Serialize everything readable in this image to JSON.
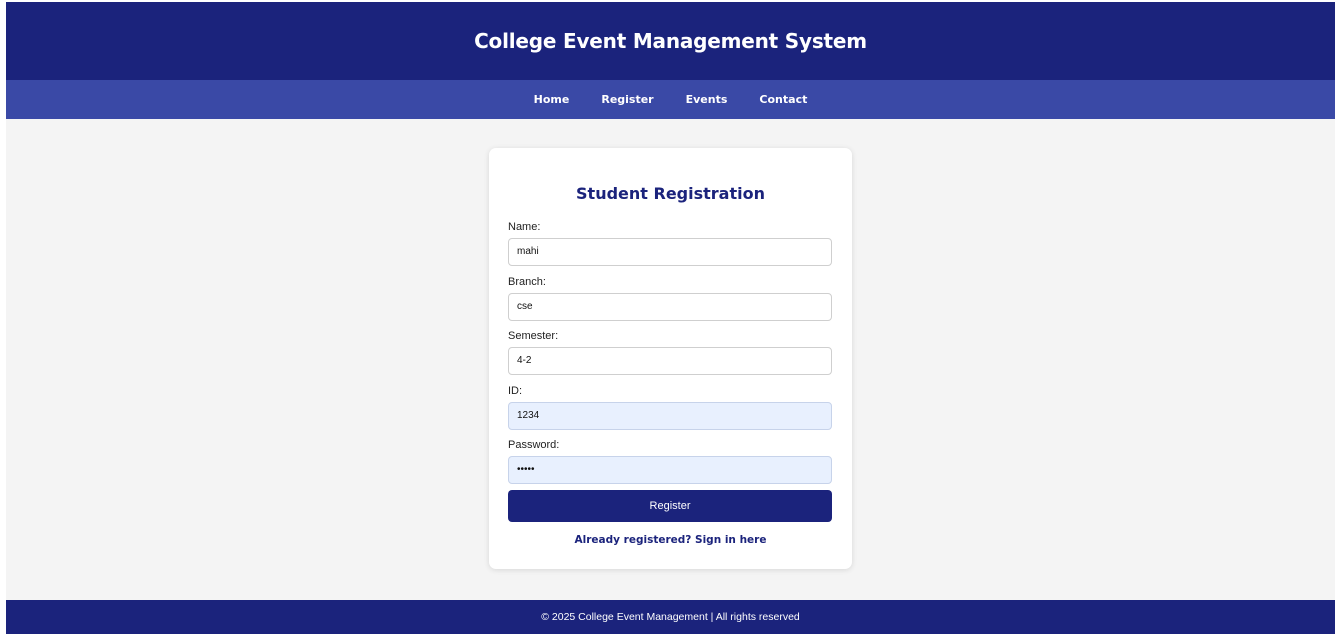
{
  "header": {
    "title": "College Event Management System"
  },
  "nav": {
    "items": [
      {
        "label": "Home"
      },
      {
        "label": "Register"
      },
      {
        "label": "Events"
      },
      {
        "label": "Contact"
      }
    ]
  },
  "form": {
    "title": "Student Registration",
    "fields": [
      {
        "label": "Name:",
        "value": "mahi"
      },
      {
        "label": "Branch:",
        "value": "cse"
      },
      {
        "label": "Semester:",
        "value": "4-2"
      },
      {
        "label": "ID:",
        "value": "1234"
      },
      {
        "label": "Password:",
        "value": "•••••"
      }
    ],
    "submit_label": "Register",
    "signin_link": "Already registered? Sign in here"
  },
  "footer": {
    "text": "© 2025 College Event Management | All rights reserved"
  },
  "colors": {
    "header_bg": "#1b237c",
    "nav_bg": "#3a49a6",
    "autofill_bg": "#e8f0fe",
    "page_bg": "#f4f4f4"
  }
}
